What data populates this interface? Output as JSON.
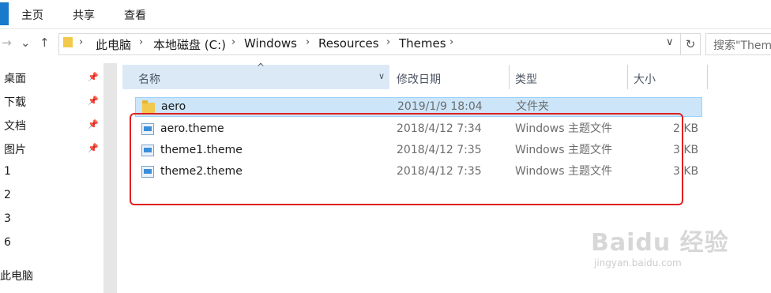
{
  "ribbon": {
    "tabs": [
      "主页",
      "共享",
      "查看"
    ]
  },
  "nav": {
    "back": "→",
    "down": "⌄",
    "up": "↑",
    "breadcrumbs": [
      "此电脑",
      "本地磁盘 (C:)",
      "Windows",
      "Resources",
      "Themes"
    ],
    "separator": "›",
    "dropdown": "∨",
    "refresh": "↻",
    "search_placeholder": "搜索\"Themes\""
  },
  "sidebar": {
    "items": [
      {
        "label": "桌面",
        "pinned": true
      },
      {
        "label": "下载",
        "pinned": true
      },
      {
        "label": "文档",
        "pinned": true
      },
      {
        "label": "图片",
        "pinned": true
      },
      {
        "label": "1",
        "pinned": false
      },
      {
        "label": "2",
        "pinned": false
      },
      {
        "label": "3",
        "pinned": false
      },
      {
        "label": "6",
        "pinned": false
      },
      {
        "label": "此电脑",
        "pinned": false
      }
    ],
    "pin_glyph": "📌"
  },
  "columns": {
    "name": "名称",
    "date": "修改日期",
    "type": "类型",
    "size": "大小",
    "sort_glyph": "^",
    "filter_glyph": "∨"
  },
  "files": [
    {
      "name": "aero",
      "date": "2019/1/9 18:04",
      "type": "文件夹",
      "size": "",
      "icon": "folder-icon",
      "selected": true
    },
    {
      "name": "aero.theme",
      "date": "2018/4/12 7:34",
      "type": "Windows 主题文件",
      "size": "2 KB",
      "icon": "theme-file-icon",
      "selected": false
    },
    {
      "name": "theme1.theme",
      "date": "2018/4/12 7:35",
      "type": "Windows 主题文件",
      "size": "3 KB",
      "icon": "theme-file-icon",
      "selected": false
    },
    {
      "name": "theme2.theme",
      "date": "2018/4/12 7:35",
      "type": "Windows 主题文件",
      "size": "3 KB",
      "icon": "theme-file-icon",
      "selected": false
    }
  ],
  "watermark": {
    "text": "Baidu 经验",
    "sub": "jingyan.baidu.com"
  },
  "colors": {
    "accent": "#1979ca",
    "header_bg": "#dbe9f7",
    "selection": "#cce5f9",
    "highlight": "#e02020"
  }
}
